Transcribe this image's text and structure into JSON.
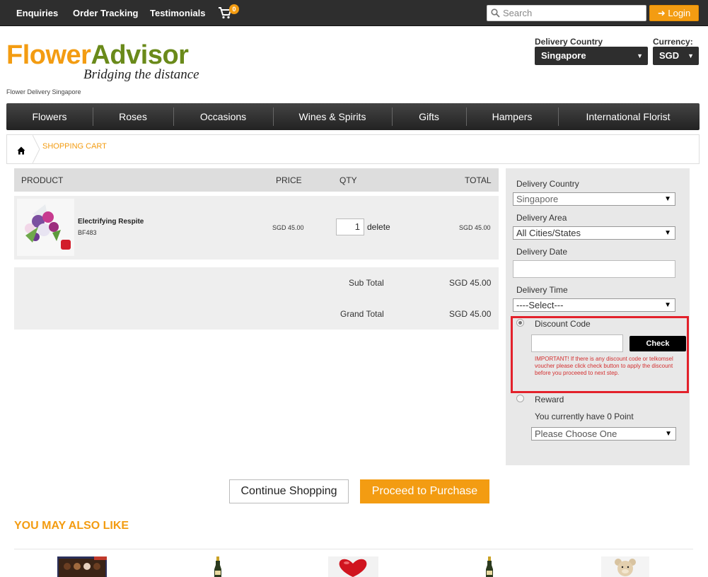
{
  "topbar": {
    "links": [
      "Enquiries",
      "Order Tracking",
      "Testimonials"
    ],
    "cart_count": "0",
    "search_placeholder": "Search",
    "login_label": "Login"
  },
  "brand": {
    "logo_part1": "Flower",
    "logo_part2": "Advisor",
    "tagline": "Bridging the distance",
    "subtitle": "Flower Delivery Singapore",
    "accent": "#f39c12",
    "green": "#6a8a1a"
  },
  "header_selectors": {
    "delivery_country_label": "Delivery Country",
    "delivery_country_value": "Singapore",
    "currency_label": "Currency:",
    "currency_value": "SGD"
  },
  "nav": [
    "Flowers",
    "Roses",
    "Occasions",
    "Wines & Spirits",
    "Gifts",
    "Hampers",
    "International Florist"
  ],
  "breadcrumb": "SHOPPING CART",
  "cart": {
    "headers": {
      "product": "PRODUCT",
      "price": "PRICE",
      "qty": "QTY",
      "total": "TOTAL"
    },
    "item": {
      "name": "Electrifying Respite",
      "code": "BF483",
      "price": "SGD 45.00",
      "qty": "1",
      "delete_label": "delete",
      "total": "SGD 45.00"
    },
    "subtotal_label": "Sub Total",
    "subtotal_value": "SGD 45.00",
    "grandtotal_label": "Grand Total",
    "grandtotal_value": "SGD 45.00"
  },
  "sidebar": {
    "country_label": "Delivery Country",
    "country_value": "Singapore",
    "area_label": "Delivery Area",
    "area_value": "All Cities/States",
    "date_label": "Delivery Date",
    "time_label": "Delivery Time",
    "time_value": "----Select---",
    "discount_label": "Discount Code",
    "check_label": "Check",
    "warning": "IMPORTANT! If there is any discount code or telkomsel voucher please click check button to apply the discount before you proceeed to next step.",
    "reward_label": "Reward",
    "points_text": "You currently have 0 Point",
    "reward_select": "Please Choose One"
  },
  "actions": {
    "continue_label": "Continue Shopping",
    "proceed_label": "Proceed to Purchase"
  },
  "recommend_title": "YOU MAY ALSO LIKE"
}
